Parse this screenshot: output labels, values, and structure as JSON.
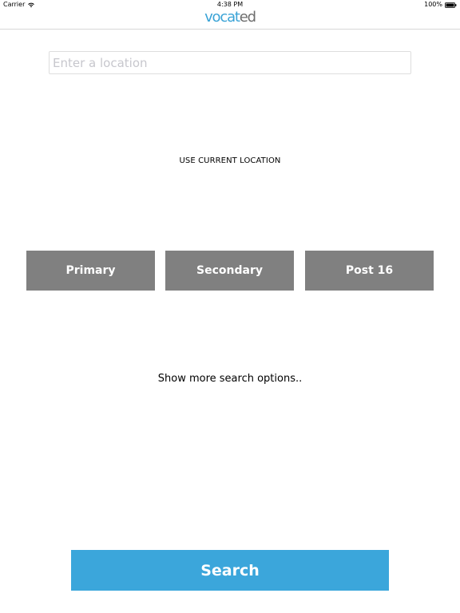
{
  "status_bar": {
    "carrier": "Carrier",
    "time": "4:38 PM",
    "battery": "100%",
    "wifi_icon": "wifi-icon",
    "battery_icon": "battery-icon"
  },
  "nav": {
    "logo_part1": "vocat",
    "logo_part2": "ed",
    "logo_colors": {
      "blue": "#3aa3d6",
      "gray": "#6d6d6d"
    }
  },
  "location": {
    "placeholder": "Enter a location",
    "value": ""
  },
  "use_current_location": "USE CURRENT LOCATION",
  "categories": [
    {
      "label": "Primary"
    },
    {
      "label": "Secondary"
    },
    {
      "label": "Post 16"
    }
  ],
  "category_color": "#808080",
  "more_options": "Show more search options..",
  "search": {
    "label": "Search",
    "color": "#3ba6db"
  }
}
